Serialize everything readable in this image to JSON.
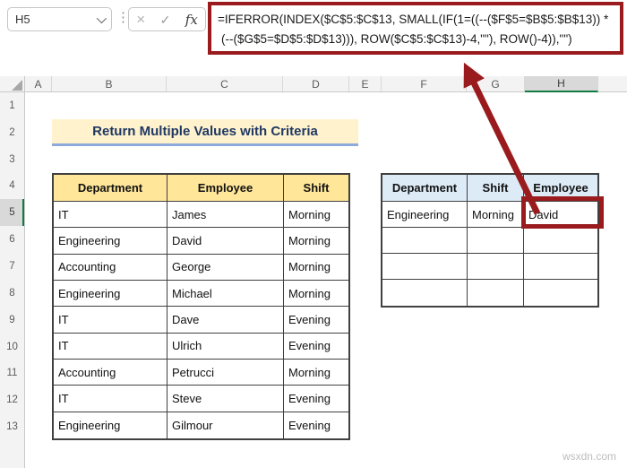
{
  "formula_bar": {
    "name_box_value": "H5",
    "cancel_icon": "×",
    "enter_icon": "✓",
    "fx_label": "fx",
    "dots": "⋮"
  },
  "formula": {
    "line1": "=IFERROR(INDEX($C$5:$C$13, SMALL(IF(1=((--($F$5=$B$5:$B$13)) *",
    "line2": "(--($G$5=$D$5:$D$13))), ROW($C$5:$C$13)-4,\"\"), ROW()-4)),\"\")"
  },
  "columns": [
    "A",
    "B",
    "C",
    "D",
    "E",
    "F",
    "G",
    "H"
  ],
  "rows": [
    "1",
    "2",
    "3",
    "4",
    "5",
    "6",
    "7",
    "8",
    "9",
    "10",
    "11",
    "12",
    "13"
  ],
  "selection": {
    "cell": "H5",
    "column": "H",
    "row": "5"
  },
  "title": {
    "text": "Return Multiple Values with Criteria"
  },
  "left_table": {
    "headers": [
      "Department",
      "Employee",
      "Shift"
    ],
    "rows": [
      [
        "IT",
        "James",
        "Morning"
      ],
      [
        "Engineering",
        "David",
        "Morning"
      ],
      [
        "Accounting",
        "George",
        "Morning"
      ],
      [
        "Engineering",
        "Michael",
        "Morning"
      ],
      [
        "IT",
        "Dave",
        "Evening"
      ],
      [
        "IT",
        "Ulrich",
        "Evening"
      ],
      [
        "Accounting",
        "Petrucci",
        "Morning"
      ],
      [
        "IT",
        "Steve",
        "Evening"
      ],
      [
        "Engineering",
        "Gilmour",
        "Evening"
      ]
    ]
  },
  "right_table": {
    "headers": [
      "Department",
      "Shift",
      "Employee"
    ],
    "rows": [
      [
        "Engineering",
        "Morning",
        "David"
      ],
      [
        "",
        "",
        ""
      ],
      [
        "",
        "",
        ""
      ],
      [
        "",
        "",
        ""
      ]
    ],
    "highlighted_cell": "H5"
  },
  "watermark": {
    "text": "wsxdn.com"
  },
  "colors": {
    "annotation_red": "#9a1b1e",
    "excel_green": "#107C41",
    "left_header_bg": "#FFE699",
    "right_header_bg": "#DDEBF7",
    "title_bg": "#FFF2CC",
    "title_text": "#1F3864",
    "title_border": "#8EAADB"
  }
}
